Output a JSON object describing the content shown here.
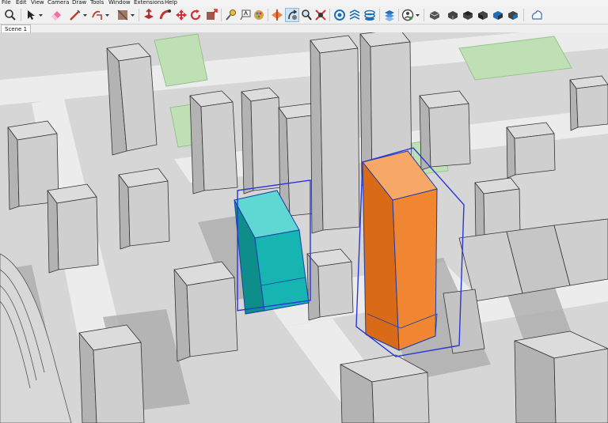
{
  "menu": [
    "File",
    "Edit",
    "View",
    "Camera",
    "Draw",
    "Tools",
    "Window",
    "Extensions",
    "Help"
  ],
  "scene_tab": "Scene 1",
  "toolbar_icons": [
    "zoom-icon",
    "select-arrow-icon",
    "eraser-icon",
    "pencil-line-icon",
    "shapes-icon",
    "paint-bucket-icon",
    "push-pull-icon",
    "follow-me-icon",
    "move-icon",
    "rotate-icon",
    "scale-icon",
    "tape-measure-icon",
    "text-label-icon",
    "paint-icon",
    "section-plane-icon",
    "orbit-icon",
    "zoom-tool-icon",
    "zoom-extents-icon",
    "3d-warehouse-icon",
    "extension-warehouse-icon",
    "layers-icon",
    "styles-icon",
    "components-icon",
    "iso-view-icon",
    "top-view-icon",
    "front-view-icon",
    "right-view-icon",
    "back-view-icon",
    "left-view-icon",
    "sign-in-icon"
  ],
  "colors": {
    "selected_teal_building": "#17b5b2",
    "selected_orange_building": "#f08532",
    "selection_outline": "#2a35d8",
    "park_green": "#bfe0b4",
    "building_gray": "#cfcfcf"
  }
}
